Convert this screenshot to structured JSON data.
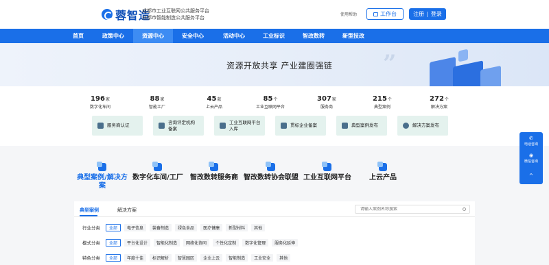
{
  "header": {
    "logo_text": "蓉智造",
    "subtitle_line1": "成都市工业互联网公共服务平台",
    "subtitle_line2": "成都市智能制造公共服务平台",
    "guide_link": "使用帮助",
    "workbench_label": "工作台",
    "register_label": "注册",
    "login_label": "登录"
  },
  "nav": {
    "items": [
      {
        "label": "首页"
      },
      {
        "label": "政策中心"
      },
      {
        "label": "资源中心"
      },
      {
        "label": "安全中心"
      },
      {
        "label": "活动中心"
      },
      {
        "label": "工业标识"
      },
      {
        "label": "智改数转"
      },
      {
        "label": "新型技改"
      }
    ],
    "active_index": 2
  },
  "banner": {
    "title": "资源开放共享 产业建圈强链"
  },
  "stats": [
    {
      "num": "196",
      "unit": "家",
      "label": "数字化车间"
    },
    {
      "num": "88",
      "unit": "家",
      "label": "智能工厂"
    },
    {
      "num": "45",
      "unit": "款",
      "label": "上云产品"
    },
    {
      "num": "85",
      "unit": "个",
      "label": "工业互联网平台"
    },
    {
      "num": "307",
      "unit": "家",
      "label": "服务商"
    },
    {
      "num": "215",
      "unit": "个",
      "label": "典型案例"
    },
    {
      "num": "272",
      "unit": "个",
      "label": "解决方案"
    }
  ],
  "services": [
    {
      "line1": "服务商认证",
      "line2": ""
    },
    {
      "line1": "咨询评定机构",
      "line2": "备案"
    },
    {
      "line1": "工业互联网平台",
      "line2": "入库"
    },
    {
      "line1": "贯标企业备案",
      "line2": ""
    },
    {
      "line1": "典型案例发布",
      "line2": ""
    },
    {
      "line1": "解决方案发布",
      "line2": ""
    }
  ],
  "floating": {
    "phone_label": "电话咨询",
    "wechat_label": "微信咨询",
    "top_icon": "^"
  },
  "categories": [
    {
      "line1": "典型案例/解决方",
      "line2": "案"
    },
    {
      "line1": "数字化车间/工厂",
      "line2": ""
    },
    {
      "line1": "智改数转服务商",
      "line2": ""
    },
    {
      "line1": "智改数转协会联盟",
      "line2": ""
    },
    {
      "line1": "工业互联网平台",
      "line2": ""
    },
    {
      "line1": "上云产品",
      "line2": ""
    }
  ],
  "panel": {
    "tabs": [
      "典型案例",
      "解决方案"
    ],
    "search_placeholder": "请输入案例名称搜索",
    "filters": [
      {
        "label": "行业分类",
        "options": [
          "全部",
          "电子信息",
          "装备制造",
          "绿色食品",
          "医疗健康",
          "新型材料",
          "其他"
        ]
      },
      {
        "label": "模式分类",
        "options": [
          "全部",
          "平台化设计",
          "智能化制造",
          "网络化协同",
          "个性化定制",
          "数字化管理",
          "服务化延伸"
        ]
      },
      {
        "label": "特色分类",
        "options": [
          "全部",
          "年度十佳",
          "标识解析",
          "智慧园区",
          "企业上云",
          "智能制造",
          "工业安全",
          "其他"
        ]
      }
    ]
  },
  "colors": {
    "primary": "#1a6fe8",
    "service_card_bg": "#e4f2ee"
  }
}
